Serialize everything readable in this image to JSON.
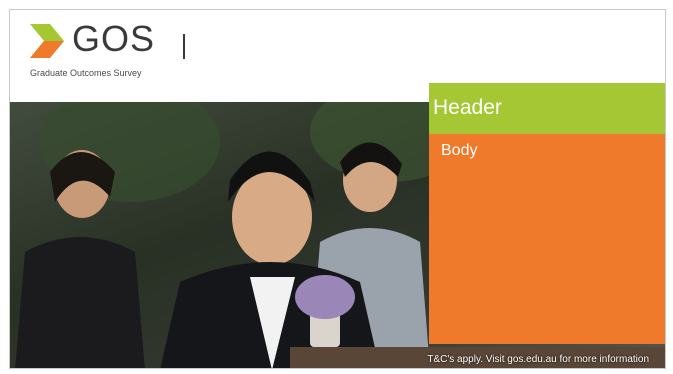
{
  "brand": {
    "name": "GOS",
    "subtitle": "Graduate Outcomes Survey",
    "colors": {
      "arrow_orange": "#f07a2c",
      "arrow_green": "#a6c734",
      "text": "#3a3a3a"
    }
  },
  "callout": {
    "header": "Header",
    "body": "Body",
    "colors": {
      "header_bg": "#a6c734",
      "body_bg": "#f07a2c"
    }
  },
  "footer": {
    "note": "T&C's apply. Visit gos.edu.au for more information"
  },
  "photo": {
    "subject": "group-photo"
  }
}
